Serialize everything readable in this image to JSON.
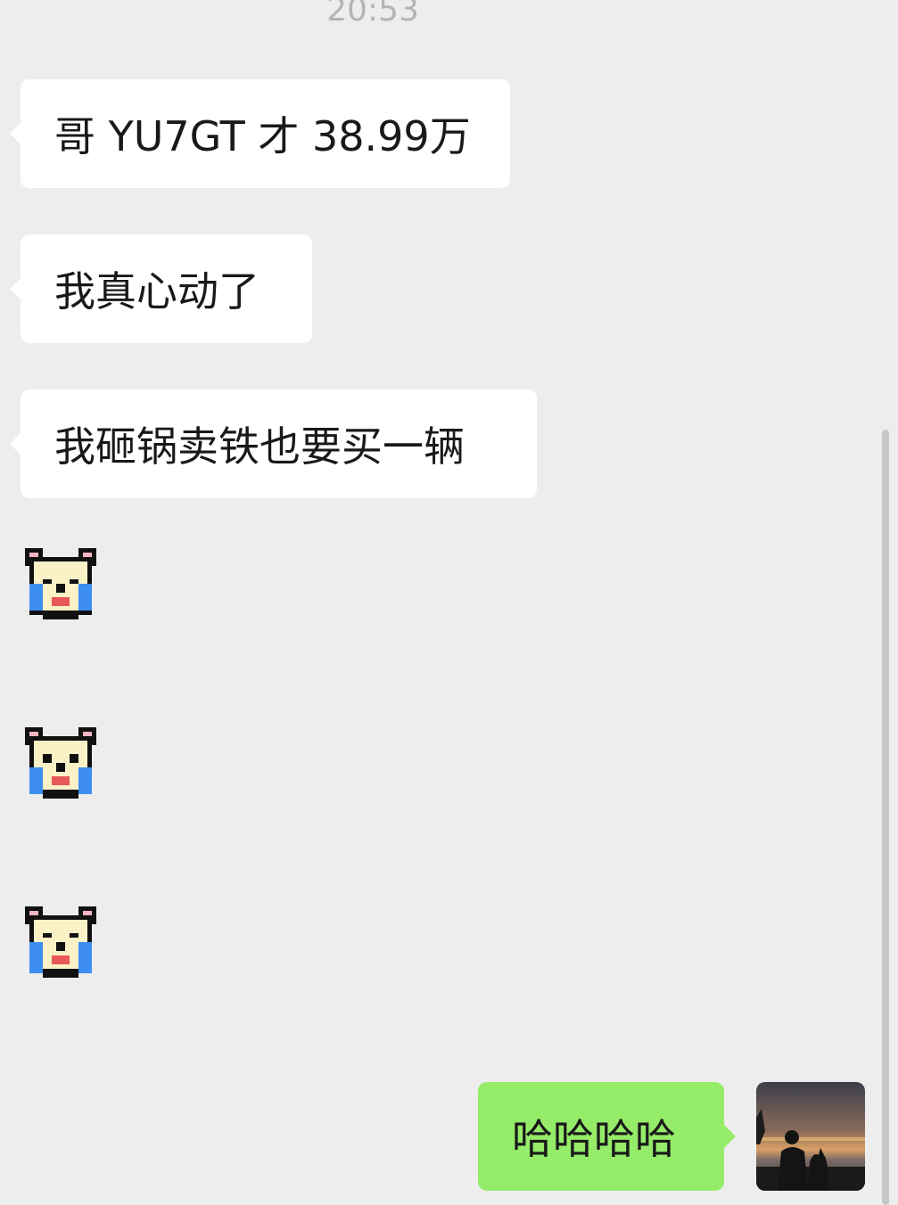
{
  "chat": {
    "timestamp": "20:53",
    "messages": [
      {
        "sender": "other",
        "type": "text",
        "text": "哥 YU7GT 才 38.99万"
      },
      {
        "sender": "other",
        "type": "text",
        "text": "我真心动了"
      },
      {
        "sender": "other",
        "type": "text",
        "text": "我砸锅卖铁也要买一辆"
      },
      {
        "sender": "other",
        "type": "sticker",
        "icon": "crying-bear-sticker-icon"
      },
      {
        "sender": "other",
        "type": "sticker",
        "icon": "crying-bear-sticker-icon"
      },
      {
        "sender": "other",
        "type": "sticker",
        "icon": "crying-bear-sticker-icon"
      },
      {
        "sender": "me",
        "type": "text",
        "text": "哈哈哈哈"
      }
    ]
  },
  "colors": {
    "background": "#ededed",
    "incoming_bubble": "#ffffff",
    "outgoing_bubble": "#95ec69",
    "text": "#191919",
    "timestamp": "#b4b4b4"
  },
  "icons": {
    "avatar": "sunset-silhouette-avatar-icon",
    "sticker": "crying-bear-sticker-icon"
  }
}
